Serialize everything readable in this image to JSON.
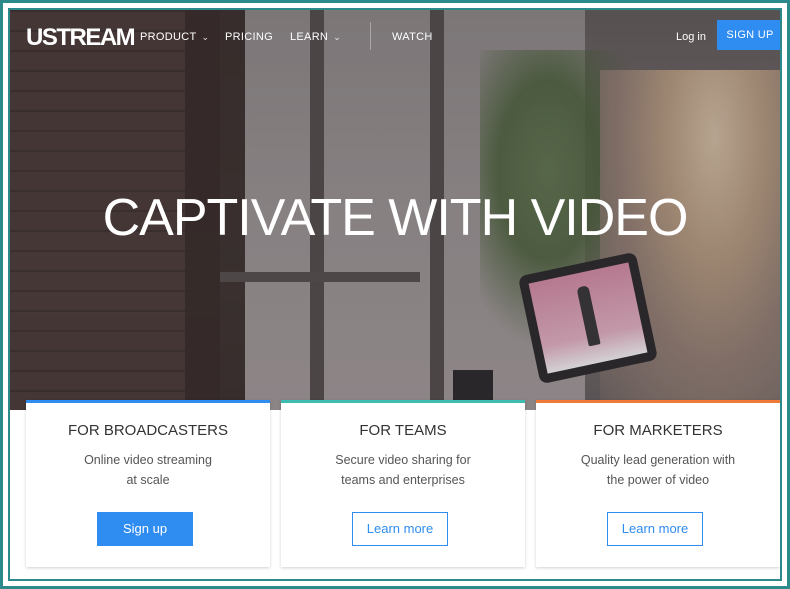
{
  "brand": {
    "logo": "USTREAM"
  },
  "nav": {
    "items": [
      {
        "label": "PRODUCT",
        "has_dropdown": true
      },
      {
        "label": "PRICING",
        "has_dropdown": false
      },
      {
        "label": "LEARN",
        "has_dropdown": true
      },
      {
        "label": "WATCH",
        "has_dropdown": false
      }
    ],
    "login": "Log in",
    "signup": "SIGN UP"
  },
  "hero": {
    "headline": "CAPTIVATE WITH VIDEO"
  },
  "cards": [
    {
      "title": "FOR BROADCASTERS",
      "desc_line1": "Online video streaming",
      "desc_line2": "at scale",
      "button": "Sign up",
      "accent": "#2f8cf0"
    },
    {
      "title": "FOR TEAMS",
      "desc_line1": "Secure video sharing for",
      "desc_line2": "teams and enterprises",
      "button": "Learn more",
      "accent": "#3fbcb0"
    },
    {
      "title": "FOR MARKETERS",
      "desc_line1": "Quality lead generation with",
      "desc_line2": "the power of video",
      "button": "Learn more",
      "accent": "#f07a3a"
    }
  ],
  "colors": {
    "primary": "#2f8cf0",
    "frame": "#2d8a8a"
  }
}
